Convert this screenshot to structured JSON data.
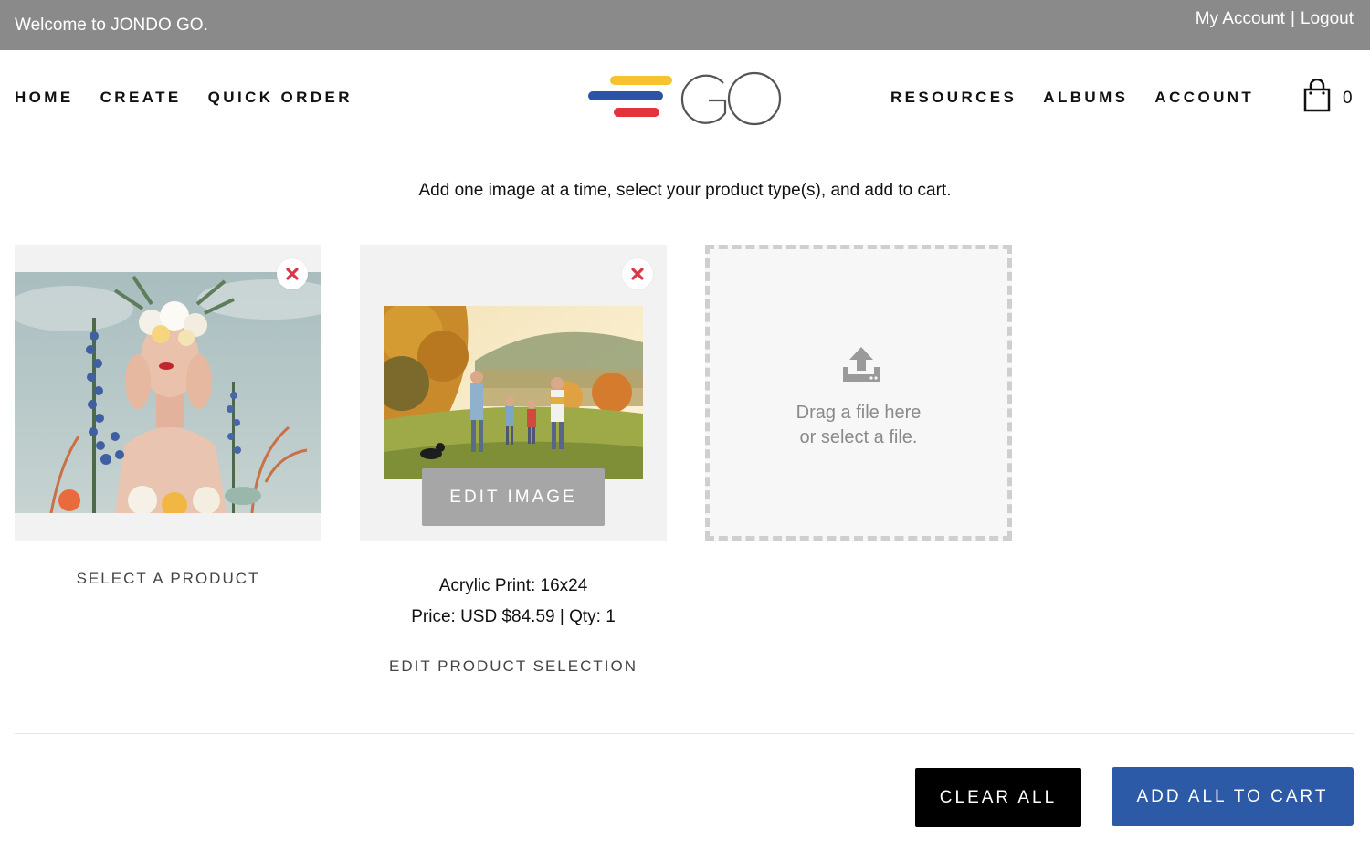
{
  "topbar": {
    "welcome": "Welcome to JONDO GO.",
    "my_account": "My Account",
    "separator": "|",
    "logout": "Logout"
  },
  "nav": {
    "left": [
      "HOME",
      "CREATE",
      "QUICK ORDER"
    ],
    "right": [
      "RESOURCES",
      "ALBUMS",
      "ACCOUNT"
    ],
    "logo_text": "GO",
    "cart_count": "0"
  },
  "main": {
    "instruction": "Add one image at a time, select your product type(s), and add to cart.",
    "card1": {
      "action": "SELECT A PRODUCT"
    },
    "card2": {
      "edit_image": "EDIT IMAGE",
      "product": "Acrylic Print: 16x24",
      "price_line": "Price: USD $84.59 | Qty: 1",
      "edit_selection": "EDIT PRODUCT SELECTION"
    },
    "dropzone": {
      "line1": "Drag a file here",
      "line2": "or select a file."
    }
  },
  "footer": {
    "clear_all": "CLEAR ALL",
    "add_all": "ADD ALL TO CART"
  },
  "colors": {
    "topbar_bg": "#8a8a8a",
    "primary_blue": "#2d5aa6",
    "remove_red": "#d9364a",
    "logo_yellow": "#f5c330",
    "logo_blue": "#2c53a6",
    "logo_red": "#e3343c"
  },
  "icons": [
    "close-icon",
    "shopping-bag-icon",
    "upload-icon"
  ]
}
